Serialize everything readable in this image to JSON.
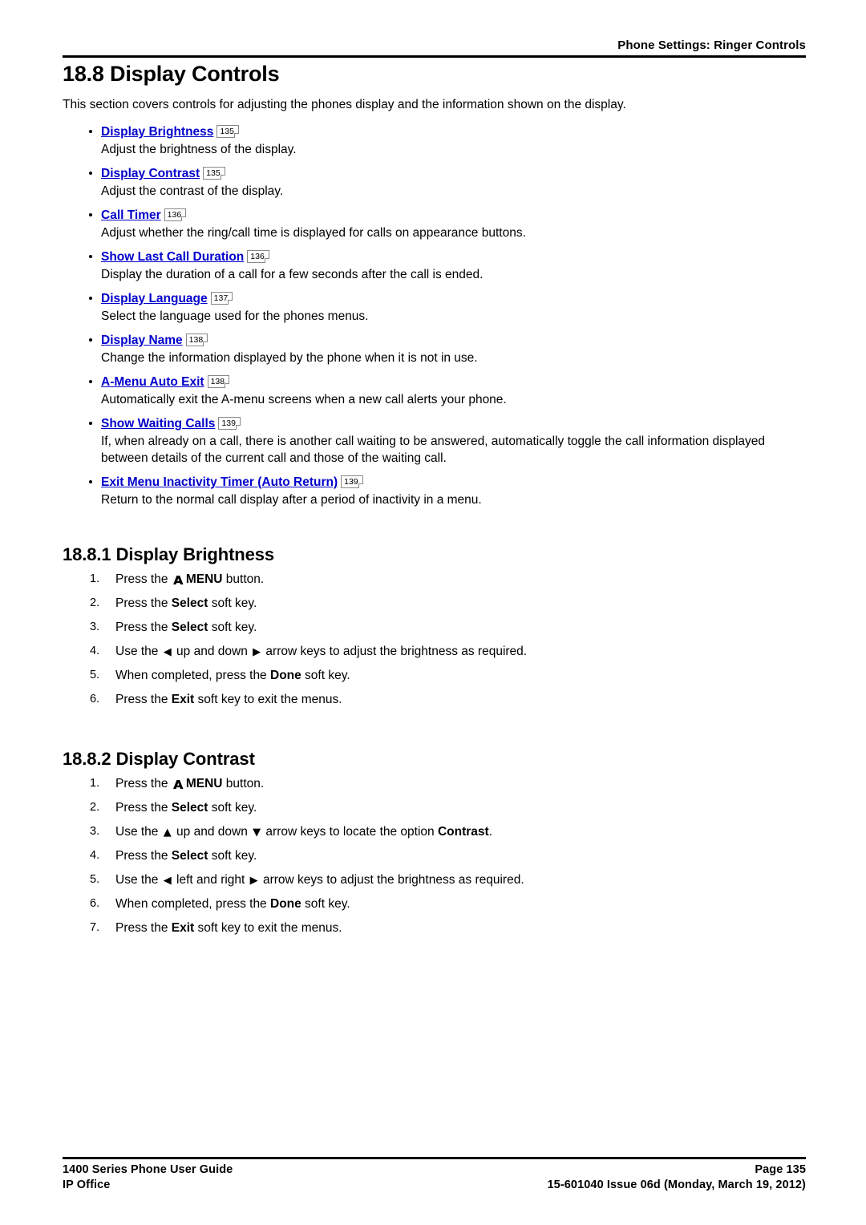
{
  "header": {
    "title": "Phone Settings: Ringer Controls"
  },
  "section": {
    "heading": "18.8 Display Controls",
    "intro": "This section covers controls for adjusting the phones display and the information shown on the display."
  },
  "bullets": [
    {
      "link": "Display Brightness",
      "pageref": "135",
      "desc": "Adjust the brightness of the display."
    },
    {
      "link": "Display Contrast",
      "pageref": "135",
      "desc": "Adjust the contrast of the display."
    },
    {
      "link": "Call Timer",
      "pageref": "136",
      "desc": "Adjust whether the ring/call time is displayed for calls on appearance buttons."
    },
    {
      "link": "Show Last Call Duration",
      "pageref": "136",
      "desc": "Display the duration of a call for a few seconds after the call is ended."
    },
    {
      "link": "Display Language",
      "pageref": "137",
      "desc": "Select the language used for the phones menus."
    },
    {
      "link": "Display Name",
      "pageref": "138",
      "desc": "Change the information displayed by the phone when it is not in use."
    },
    {
      "link": "A-Menu Auto Exit",
      "pageref": "138",
      "desc": "Automatically exit the A-menu screens when a new call alerts your phone."
    },
    {
      "link": "Show Waiting Calls",
      "pageref": "139",
      "desc": "If, when already on a call, there is another call waiting to be answered, automatically toggle the call information displayed between details of the current call and those of the waiting call."
    },
    {
      "link": "Exit Menu Inactivity Timer (Auto Return)",
      "pageref": "139",
      "desc": "Return to the normal call display after a period of inactivity in a menu."
    }
  ],
  "subsection_brightness": {
    "heading": "18.8.1 Display Brightness",
    "steps": [
      {
        "num": "1.",
        "pre": "Press the ",
        "glyph": "menu-arrow-icon",
        "glyph_char": "ᴀ",
        "mid": "MENU",
        "post": " button."
      },
      {
        "num": "2.",
        "pre": "Press the ",
        "mid": "Select",
        "post": " soft key."
      },
      {
        "num": "3.",
        "pre": "Press the ",
        "mid": "Select",
        "post": " soft key."
      },
      {
        "num": "4.",
        "pre": "Use the ",
        "glyph_char": "◀",
        "mid2": " up and down ",
        "glyph_char2": "▶",
        "post": " arrow keys to adjust the brightness as required."
      },
      {
        "num": "5.",
        "pre": "When completed, press the ",
        "mid": "Done",
        "post": " soft key."
      },
      {
        "num": "6.",
        "pre": "Press the ",
        "mid": "Exit",
        "post": " soft key to exit the menus."
      }
    ]
  },
  "subsection_contrast": {
    "heading": "18.8.2 Display Contrast",
    "steps": [
      {
        "num": "1.",
        "pre": "Press the ",
        "glyph_char": "ᴀ",
        "mid": "MENU",
        "post": " button."
      },
      {
        "num": "2.",
        "pre": "Press the ",
        "mid": "Select",
        "post": " soft key."
      },
      {
        "num": "3.",
        "pre": "Use the ",
        "glyph_char": "▲",
        "mid2": " up and down ",
        "glyph_char2": "▼",
        "post": " arrow keys to locate the option ",
        "mid": "Contrast",
        "tail": "."
      },
      {
        "num": "4.",
        "pre": "Press the ",
        "mid": "Select",
        "post": " soft key."
      },
      {
        "num": "5.",
        "pre": "Use the ",
        "glyph_char": "◀",
        "mid2": " left and right ",
        "glyph_char2": "▶",
        "post": " arrow keys to adjust the brightness as required."
      },
      {
        "num": "6.",
        "pre": "When completed, press the ",
        "mid": "Done",
        "post": " soft key."
      },
      {
        "num": "7.",
        "pre": "Press the ",
        "mid": "Exit",
        "post": " soft key to exit the menus."
      }
    ]
  },
  "footer": {
    "left_line1": "1400 Series Phone User Guide",
    "left_line2": "IP Office",
    "right_line1": "Page 135",
    "right_line2": "15-601040 Issue 06d (Monday, March 19, 2012)"
  },
  "colors": {
    "link": "#0000CC",
    "text": "#000000",
    "rule": "#000000"
  }
}
